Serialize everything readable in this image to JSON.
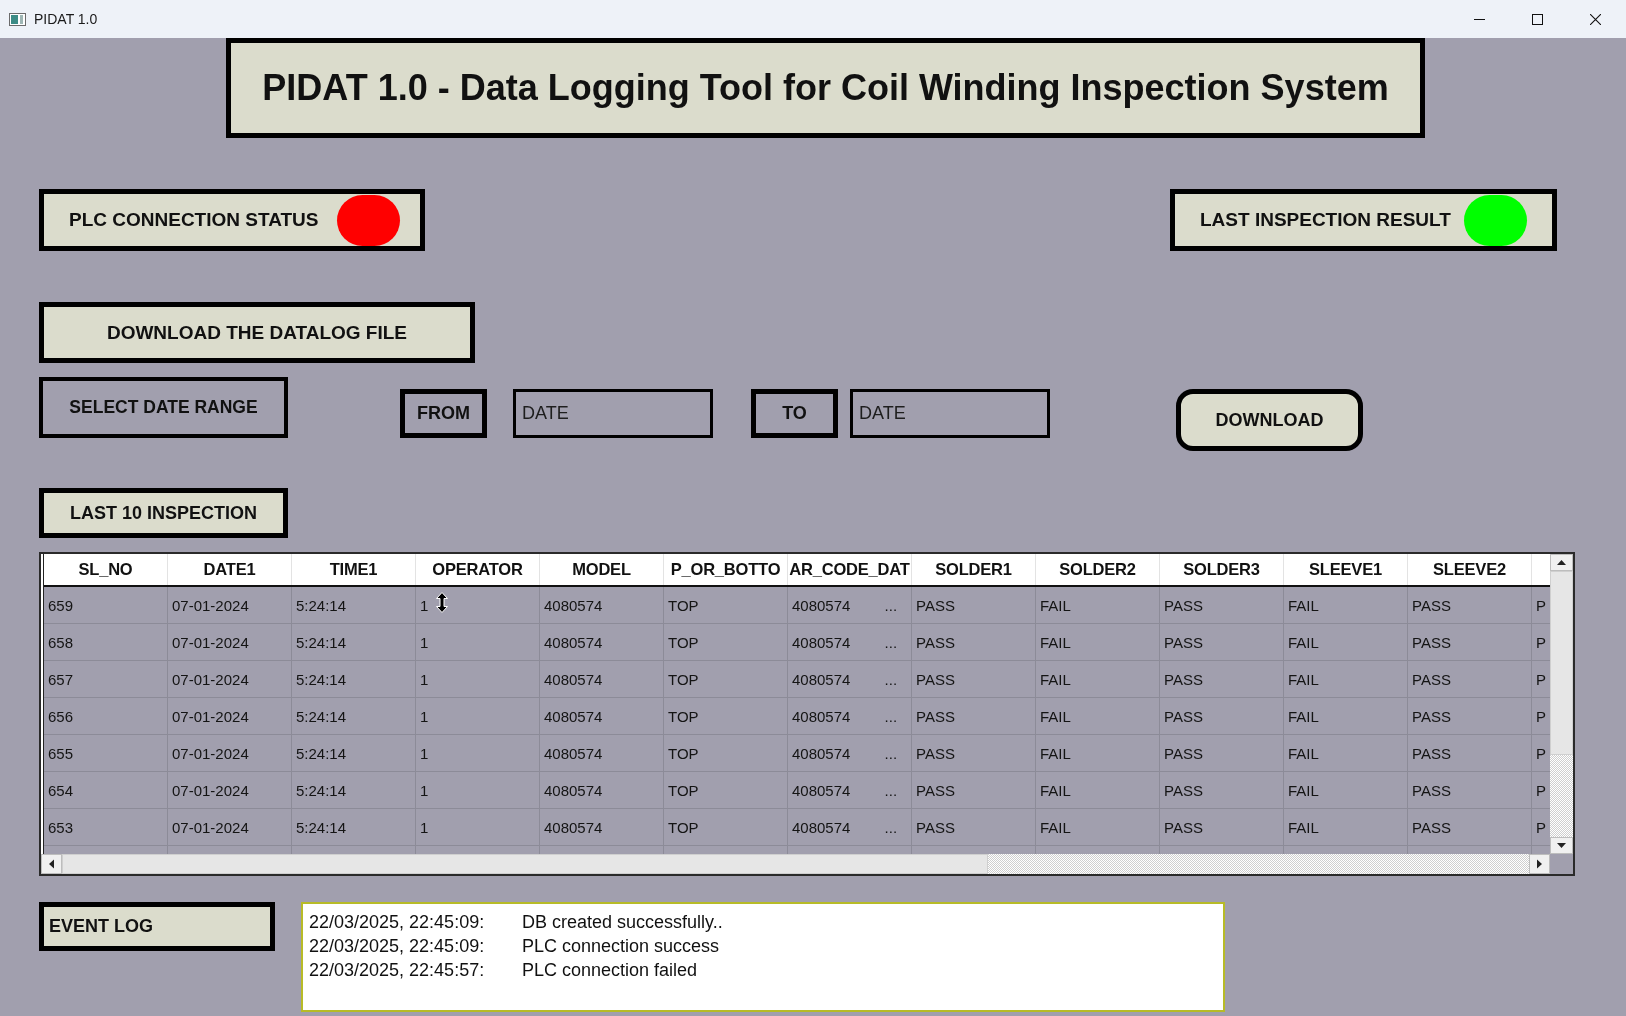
{
  "window": {
    "title": "PIDAT 1.0"
  },
  "banner": {
    "title": "PIDAT 1.0 - Data Logging Tool for Coil Winding Inspection System"
  },
  "indicators": [
    {
      "label": "PLC CONNECTION STATUS",
      "color": "#ff0000"
    },
    {
      "label": "LAST INSPECTION RESULT",
      "color": "#00ff00"
    }
  ],
  "download_section": {
    "title": "DOWNLOAD THE DATALOG FILE",
    "range_label": "SELECT DATE RANGE",
    "from_label": "FROM",
    "from_field": {
      "placeholder": "DATE"
    },
    "to_label": "TO",
    "to_field": {
      "placeholder": "DATE"
    },
    "button": "DOWNLOAD"
  },
  "inspections": {
    "title": "LAST 10 INSPECTION",
    "columns": [
      "SL_NO",
      "DATE1",
      "TIME1",
      "OPERATOR",
      "MODEL",
      "P_OR_BOTTO",
      "AR_CODE_DAT",
      "SOLDER1",
      "SOLDER2",
      "SOLDER3",
      "SLEEVE1",
      "SLEEVE2"
    ],
    "rows": [
      [
        "659",
        "07-01-2024",
        "5:24:14",
        "1",
        "4080574",
        "TOP",
        "4080574 ...",
        "PASS",
        "FAIL",
        "PASS",
        "FAIL",
        "PASS",
        "P"
      ],
      [
        "658",
        "07-01-2024",
        "5:24:14",
        "1",
        "4080574",
        "TOP",
        "4080574 ...",
        "PASS",
        "FAIL",
        "PASS",
        "FAIL",
        "PASS",
        "P"
      ],
      [
        "657",
        "07-01-2024",
        "5:24:14",
        "1",
        "4080574",
        "TOP",
        "4080574 ...",
        "PASS",
        "FAIL",
        "PASS",
        "FAIL",
        "PASS",
        "P"
      ],
      [
        "656",
        "07-01-2024",
        "5:24:14",
        "1",
        "4080574",
        "TOP",
        "4080574 ...",
        "PASS",
        "FAIL",
        "PASS",
        "FAIL",
        "PASS",
        "P"
      ],
      [
        "655",
        "07-01-2024",
        "5:24:14",
        "1",
        "4080574",
        "TOP",
        "4080574 ...",
        "PASS",
        "FAIL",
        "PASS",
        "FAIL",
        "PASS",
        "P"
      ],
      [
        "654",
        "07-01-2024",
        "5:24:14",
        "1",
        "4080574",
        "TOP",
        "4080574 ...",
        "PASS",
        "FAIL",
        "PASS",
        "FAIL",
        "PASS",
        "P"
      ],
      [
        "653",
        "07-01-2024",
        "5:24:14",
        "1",
        "4080574",
        "TOP",
        "4080574 ...",
        "PASS",
        "FAIL",
        "PASS",
        "FAIL",
        "PASS",
        "P"
      ]
    ]
  },
  "event_log": {
    "title": "EVENT LOG",
    "entries": [
      {
        "time": "22/03/2025, 22:45:09:",
        "message": "DB created successfully.."
      },
      {
        "time": "22/03/2025, 22:45:09:",
        "message": "PLC connection success"
      },
      {
        "time": "22/03/2025, 22:45:57:",
        "message": "PLC connection failed"
      }
    ]
  }
}
